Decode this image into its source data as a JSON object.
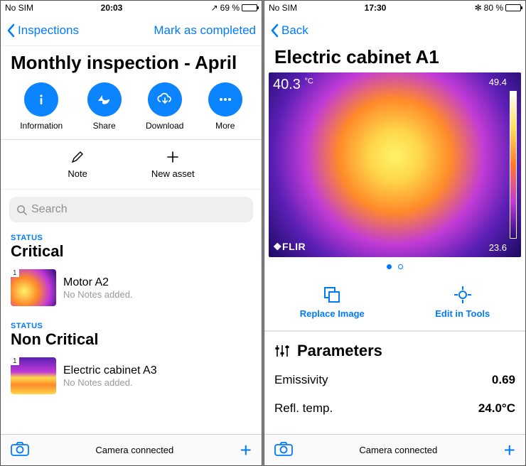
{
  "left": {
    "status": {
      "carrier": "No SIM",
      "time": "20:03",
      "loc": "↗",
      "batt_pct": "69 %",
      "batt_fill": 69
    },
    "nav": {
      "back": "Inspections",
      "right": "Mark as completed"
    },
    "title": "Monthly inspection - April",
    "actions": [
      {
        "name": "information",
        "label": "Information"
      },
      {
        "name": "share",
        "label": "Share"
      },
      {
        "name": "download",
        "label": "Download"
      },
      {
        "name": "more",
        "label": "More"
      }
    ],
    "secondary": [
      {
        "name": "note",
        "label": "Note"
      },
      {
        "name": "new-asset",
        "label": "New asset"
      }
    ],
    "search_placeholder": "Search",
    "status_header": "STATUS",
    "groups": [
      {
        "title": "Critical",
        "items": [
          {
            "badge": "1",
            "title": "Motor A2",
            "sub": "No Notes added."
          }
        ]
      },
      {
        "title": "Non Critical",
        "items": [
          {
            "badge": "1",
            "title": "Electric cabinet A3",
            "sub": "No Notes added."
          }
        ]
      }
    ],
    "footer": "Camera connected"
  },
  "right": {
    "status": {
      "carrier": "No SIM",
      "time": "17:30",
      "bt": "✻",
      "batt_pct": "80 %",
      "batt_fill": 80
    },
    "nav": {
      "back": "Back"
    },
    "title": "Electric cabinet A1",
    "thermal": {
      "spot": "40.3",
      "unit": "°C",
      "max": "49.4",
      "min": "23.6",
      "brand": "❖FLIR"
    },
    "tools": [
      {
        "name": "replace-image",
        "label": "Replace Image"
      },
      {
        "name": "edit-in-tools",
        "label": "Edit in Tools"
      }
    ],
    "params_title": "Parameters",
    "params": [
      {
        "label": "Emissivity",
        "value": "0.69"
      },
      {
        "label": "Refl. temp.",
        "value": "24.0°C"
      }
    ],
    "footer": "Camera connected"
  }
}
